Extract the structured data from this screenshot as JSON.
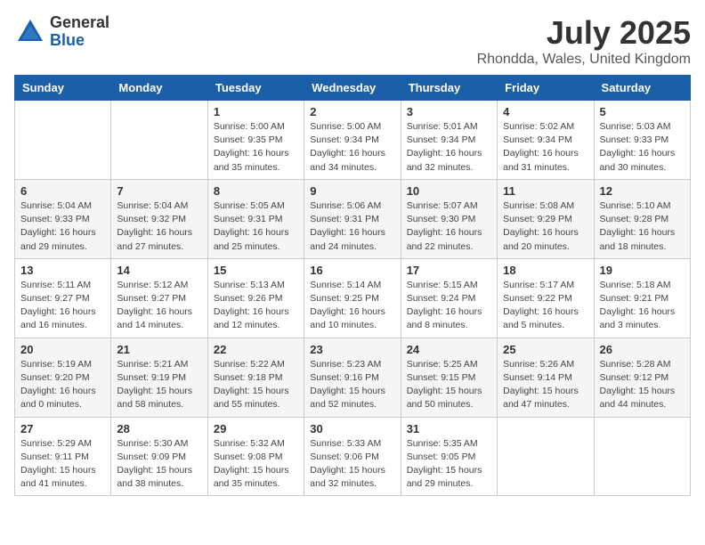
{
  "logo": {
    "general": "General",
    "blue": "Blue"
  },
  "title": "July 2025",
  "location": "Rhondda, Wales, United Kingdom",
  "days_of_week": [
    "Sunday",
    "Monday",
    "Tuesday",
    "Wednesday",
    "Thursday",
    "Friday",
    "Saturday"
  ],
  "weeks": [
    [
      {
        "day": "",
        "info": ""
      },
      {
        "day": "",
        "info": ""
      },
      {
        "day": "1",
        "info": "Sunrise: 5:00 AM\nSunset: 9:35 PM\nDaylight: 16 hours\nand 35 minutes."
      },
      {
        "day": "2",
        "info": "Sunrise: 5:00 AM\nSunset: 9:34 PM\nDaylight: 16 hours\nand 34 minutes."
      },
      {
        "day": "3",
        "info": "Sunrise: 5:01 AM\nSunset: 9:34 PM\nDaylight: 16 hours\nand 32 minutes."
      },
      {
        "day": "4",
        "info": "Sunrise: 5:02 AM\nSunset: 9:34 PM\nDaylight: 16 hours\nand 31 minutes."
      },
      {
        "day": "5",
        "info": "Sunrise: 5:03 AM\nSunset: 9:33 PM\nDaylight: 16 hours\nand 30 minutes."
      }
    ],
    [
      {
        "day": "6",
        "info": "Sunrise: 5:04 AM\nSunset: 9:33 PM\nDaylight: 16 hours\nand 29 minutes."
      },
      {
        "day": "7",
        "info": "Sunrise: 5:04 AM\nSunset: 9:32 PM\nDaylight: 16 hours\nand 27 minutes."
      },
      {
        "day": "8",
        "info": "Sunrise: 5:05 AM\nSunset: 9:31 PM\nDaylight: 16 hours\nand 25 minutes."
      },
      {
        "day": "9",
        "info": "Sunrise: 5:06 AM\nSunset: 9:31 PM\nDaylight: 16 hours\nand 24 minutes."
      },
      {
        "day": "10",
        "info": "Sunrise: 5:07 AM\nSunset: 9:30 PM\nDaylight: 16 hours\nand 22 minutes."
      },
      {
        "day": "11",
        "info": "Sunrise: 5:08 AM\nSunset: 9:29 PM\nDaylight: 16 hours\nand 20 minutes."
      },
      {
        "day": "12",
        "info": "Sunrise: 5:10 AM\nSunset: 9:28 PM\nDaylight: 16 hours\nand 18 minutes."
      }
    ],
    [
      {
        "day": "13",
        "info": "Sunrise: 5:11 AM\nSunset: 9:27 PM\nDaylight: 16 hours\nand 16 minutes."
      },
      {
        "day": "14",
        "info": "Sunrise: 5:12 AM\nSunset: 9:27 PM\nDaylight: 16 hours\nand 14 minutes."
      },
      {
        "day": "15",
        "info": "Sunrise: 5:13 AM\nSunset: 9:26 PM\nDaylight: 16 hours\nand 12 minutes."
      },
      {
        "day": "16",
        "info": "Sunrise: 5:14 AM\nSunset: 9:25 PM\nDaylight: 16 hours\nand 10 minutes."
      },
      {
        "day": "17",
        "info": "Sunrise: 5:15 AM\nSunset: 9:24 PM\nDaylight: 16 hours\nand 8 minutes."
      },
      {
        "day": "18",
        "info": "Sunrise: 5:17 AM\nSunset: 9:22 PM\nDaylight: 16 hours\nand 5 minutes."
      },
      {
        "day": "19",
        "info": "Sunrise: 5:18 AM\nSunset: 9:21 PM\nDaylight: 16 hours\nand 3 minutes."
      }
    ],
    [
      {
        "day": "20",
        "info": "Sunrise: 5:19 AM\nSunset: 9:20 PM\nDaylight: 16 hours\nand 0 minutes."
      },
      {
        "day": "21",
        "info": "Sunrise: 5:21 AM\nSunset: 9:19 PM\nDaylight: 15 hours\nand 58 minutes."
      },
      {
        "day": "22",
        "info": "Sunrise: 5:22 AM\nSunset: 9:18 PM\nDaylight: 15 hours\nand 55 minutes."
      },
      {
        "day": "23",
        "info": "Sunrise: 5:23 AM\nSunset: 9:16 PM\nDaylight: 15 hours\nand 52 minutes."
      },
      {
        "day": "24",
        "info": "Sunrise: 5:25 AM\nSunset: 9:15 PM\nDaylight: 15 hours\nand 50 minutes."
      },
      {
        "day": "25",
        "info": "Sunrise: 5:26 AM\nSunset: 9:14 PM\nDaylight: 15 hours\nand 47 minutes."
      },
      {
        "day": "26",
        "info": "Sunrise: 5:28 AM\nSunset: 9:12 PM\nDaylight: 15 hours\nand 44 minutes."
      }
    ],
    [
      {
        "day": "27",
        "info": "Sunrise: 5:29 AM\nSunset: 9:11 PM\nDaylight: 15 hours\nand 41 minutes."
      },
      {
        "day": "28",
        "info": "Sunrise: 5:30 AM\nSunset: 9:09 PM\nDaylight: 15 hours\nand 38 minutes."
      },
      {
        "day": "29",
        "info": "Sunrise: 5:32 AM\nSunset: 9:08 PM\nDaylight: 15 hours\nand 35 minutes."
      },
      {
        "day": "30",
        "info": "Sunrise: 5:33 AM\nSunset: 9:06 PM\nDaylight: 15 hours\nand 32 minutes."
      },
      {
        "day": "31",
        "info": "Sunrise: 5:35 AM\nSunset: 9:05 PM\nDaylight: 15 hours\nand 29 minutes."
      },
      {
        "day": "",
        "info": ""
      },
      {
        "day": "",
        "info": ""
      }
    ]
  ]
}
